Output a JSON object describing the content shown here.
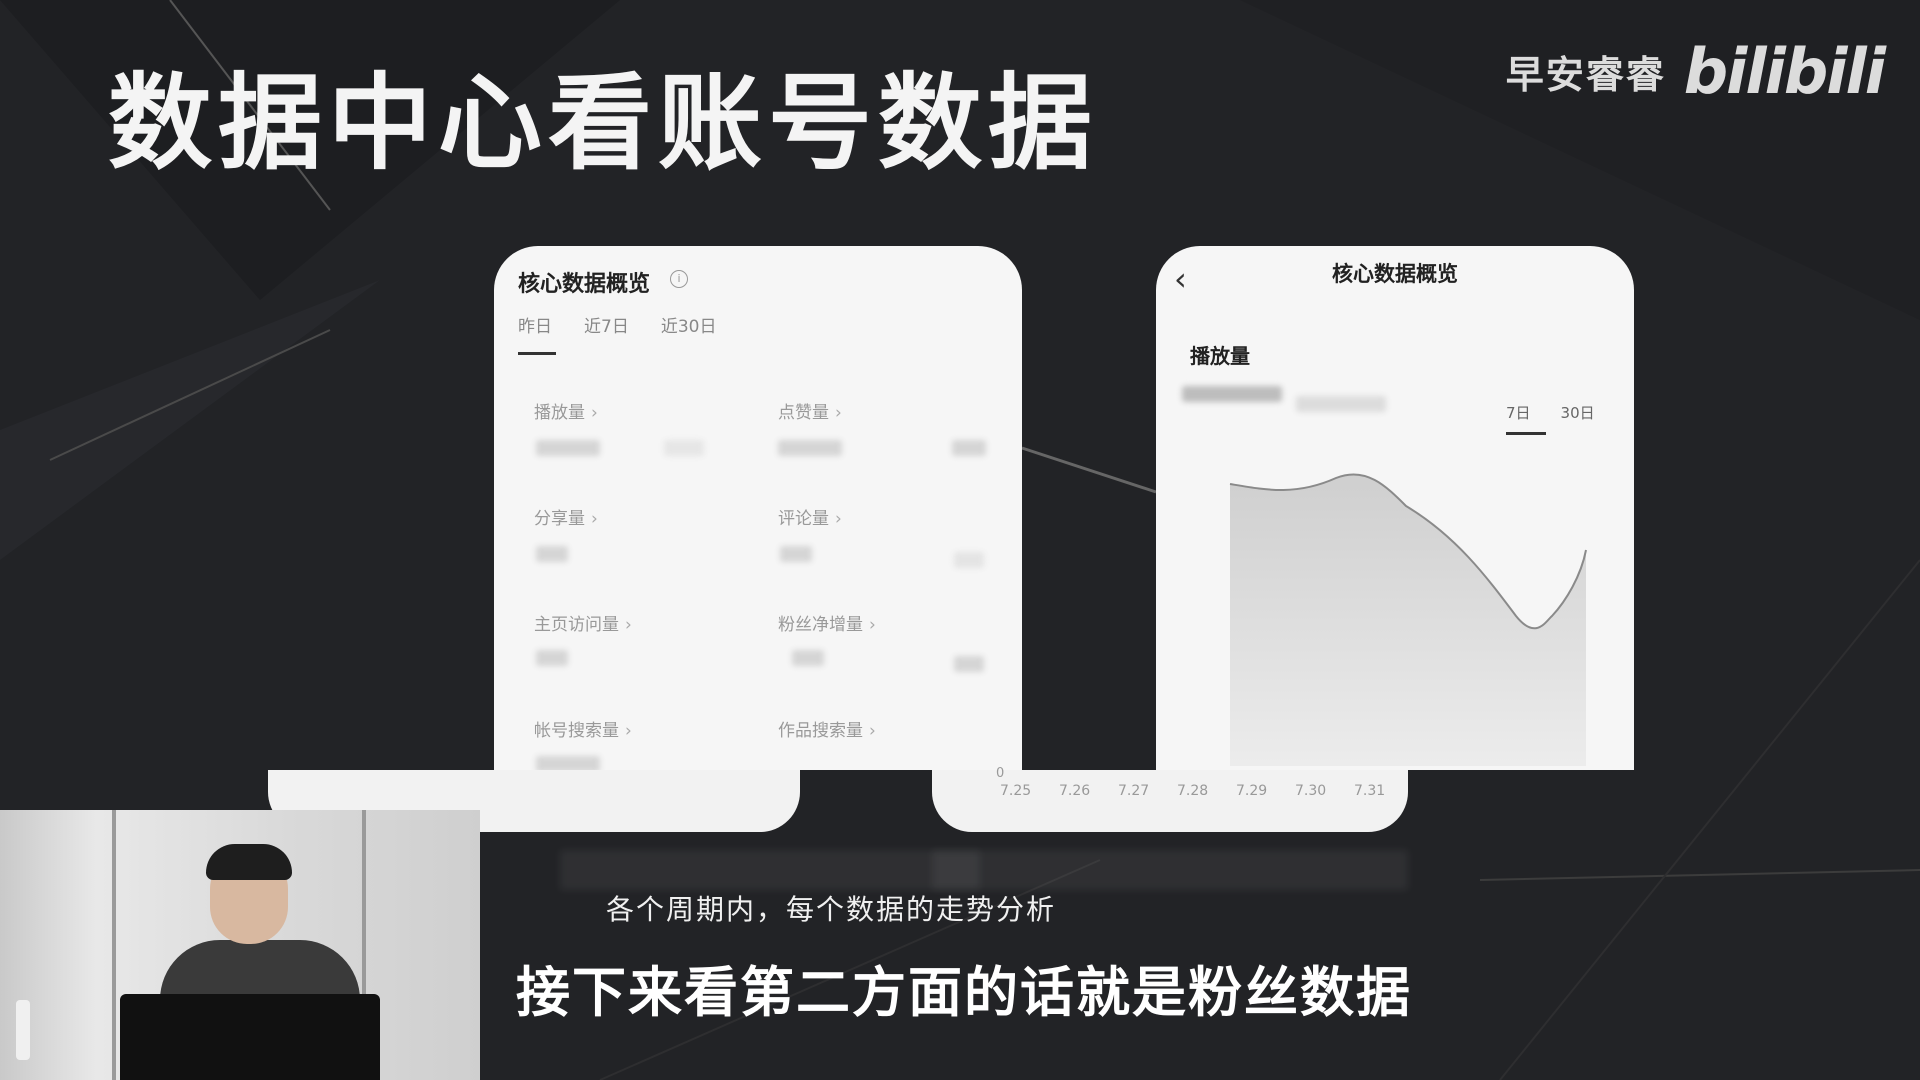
{
  "slide": {
    "title": "数据中心看账号数据",
    "brand_name": "早安睿睿",
    "brand_logo": "bilibili"
  },
  "left_phone": {
    "title": "核心数据概览",
    "info_icon": "info-circle-icon",
    "tabs": [
      "昨日",
      "近7日",
      "近30日"
    ],
    "active_tab": "昨日",
    "metrics": [
      {
        "label": "播放量"
      },
      {
        "label": "点赞量"
      },
      {
        "label": "分享量"
      },
      {
        "label": "评论量"
      },
      {
        "label": "主页访问量"
      },
      {
        "label": "粉丝净增量"
      },
      {
        "label": "帐号搜索量"
      },
      {
        "label": "作品搜索量"
      }
    ],
    "chevron": "›"
  },
  "right_phone": {
    "back_icon": "back-chevron-icon",
    "title": "核心数据概览",
    "metric_label": "播放量",
    "tabs": [
      "7日",
      "30日"
    ],
    "active_tab": "7日",
    "y_zero": "0",
    "x_labels": [
      "7.25",
      "7.26",
      "7.27",
      "7.28",
      "7.29",
      "7.30",
      "7.31"
    ]
  },
  "subtitles": {
    "small": "各个周期内，每个数据的走势分析",
    "large": "接下来看第二方面的话就是粉丝数据"
  }
}
